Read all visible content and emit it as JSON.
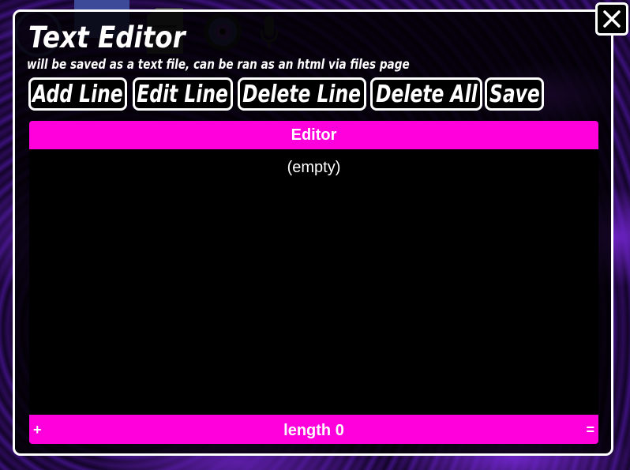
{
  "window": {
    "title": "Text Editor",
    "subtitle": "will be saved as a text file, can be ran as an html via files page"
  },
  "toolbar": {
    "add_line_label": "Add Line",
    "edit_line_label": "Edit Line",
    "delete_line_label": "Delete Line",
    "delete_all_label": "Delete All",
    "save_label": "Save"
  },
  "editor": {
    "header": "Editor",
    "empty_text": "(empty)",
    "footer": {
      "plus_label": "+",
      "length_label": "length 0",
      "equals_label": "="
    }
  },
  "icons": {
    "close": "close-icon",
    "background_apps": [
      "circle-icon",
      "folder-icon",
      "document-icon",
      "camera-lens-icon",
      "microphone-icon"
    ]
  },
  "colors": {
    "accent": "#ff00dd",
    "window_border": "#ffffff",
    "editor_bg": "#000000",
    "background": "#1b0838"
  }
}
